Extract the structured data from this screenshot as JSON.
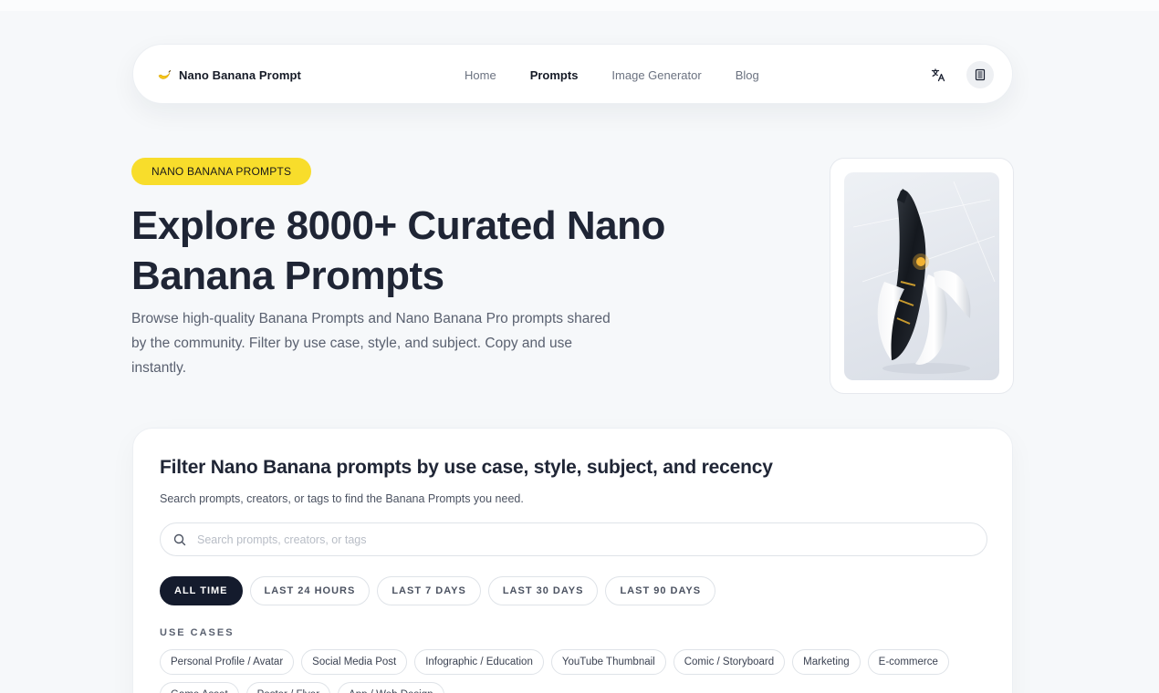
{
  "nav": {
    "brand": "Nano Banana Prompt",
    "links": [
      {
        "label": "Home",
        "active": false
      },
      {
        "label": "Prompts",
        "active": true
      },
      {
        "label": "Image Generator",
        "active": false
      },
      {
        "label": "Blog",
        "active": false
      }
    ],
    "actions": [
      "translate-icon",
      "theme-icon"
    ]
  },
  "hero": {
    "badge": "NANO BANANA PROMPTS",
    "title": "Explore 8000+ Curated Nano Banana Prompts",
    "description": "Browse high-quality Banana Prompts and Nano Banana Pro prompts shared by the community. Filter by use case, style, and subject. Copy and use instantly."
  },
  "filter": {
    "title": "Filter Nano Banana prompts by use case, style, subject, and recency",
    "subtitle": "Search prompts, creators, or tags to find the Banana Prompts you need.",
    "search_placeholder": "Search prompts, creators, or tags",
    "time_ranges": [
      {
        "label": "ALL TIME",
        "active": true
      },
      {
        "label": "LAST 24 HOURS",
        "active": false
      },
      {
        "label": "LAST 7 DAYS",
        "active": false
      },
      {
        "label": "LAST 30 DAYS",
        "active": false
      },
      {
        "label": "LAST 90 DAYS",
        "active": false
      }
    ],
    "use_cases_label": "USE CASES",
    "use_cases": [
      "Personal Profile / Avatar",
      "Social Media Post",
      "Infographic / Education",
      "YouTube Thumbnail",
      "Comic / Storyboard",
      "Marketing",
      "E-commerce",
      "Game Asset",
      "Poster / Flyer",
      "App / Web Design"
    ]
  },
  "colors": {
    "accent_yellow": "#f8dd2b",
    "active_pill": "#141b2d",
    "background": "#f6f8fa"
  }
}
